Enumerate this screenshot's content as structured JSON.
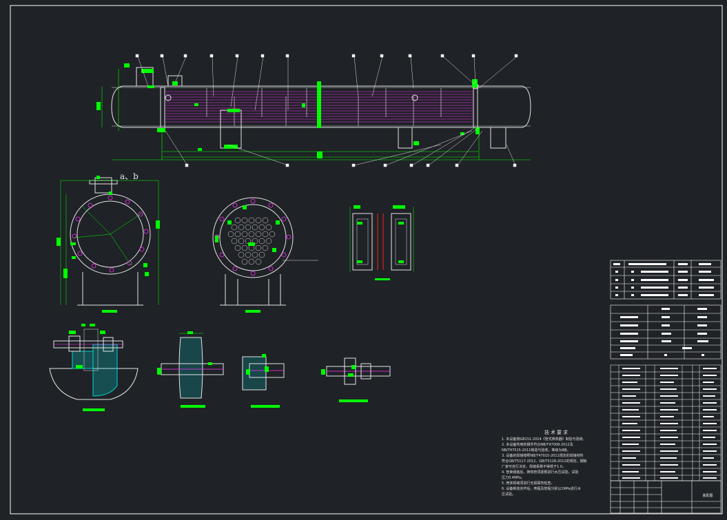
{
  "view_labels": {
    "side_view_mark": "a、b"
  },
  "technical_requirements": {
    "title": "技术要求",
    "lines": [
      "1. 本设备按GB151-2014《管式换热器》制造与验收。",
      "2. 本设备所用的钢件符合NB/T47008-2012及",
      "NB/T47015-2011制造与验收，等级为Ⅱ级。",
      "3. 设备的焊接按照NB/T47015-2011规定的焊接材料",
      "符合GB/T5117-2012、GB/T5118-2012的规定。钢板",
      "厂家可自行决定，焊缝系数不得低于1.0。",
      "4. 管束组装后，换热管须逐根进行水压试验，试验",
      "压力0.4MPa。",
      "5. 壳体焊缝须进行无损探伤检查。",
      "6. 设备制造完毕后，壳程及管程分别以1MPa进行水",
      "压试验。"
    ]
  },
  "title_block": {
    "drawing_title": "装配图"
  },
  "colors": {
    "background": "#1f2226",
    "frame": "#ffffff",
    "outline": "#e6e6e6",
    "tubes": "#ff2dff",
    "dimensions": "#00ff00",
    "section_hatch": "#00d5d5",
    "bolts": "#ff2020"
  }
}
